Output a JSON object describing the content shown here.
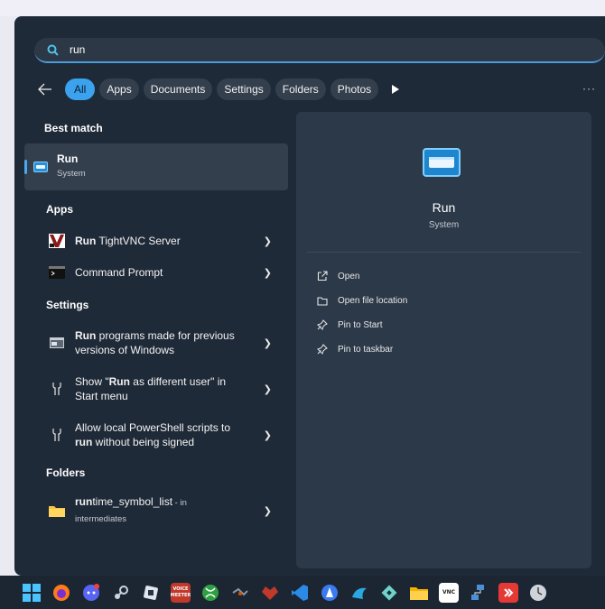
{
  "search": {
    "value": "run"
  },
  "filters": {
    "chips": [
      "All",
      "Apps",
      "Documents",
      "Settings",
      "Folders",
      "Photos"
    ],
    "more": "···"
  },
  "best_match": {
    "header": "Best match",
    "item": {
      "title": "Run",
      "subtitle": "System"
    }
  },
  "apps": {
    "header": "Apps",
    "items": [
      {
        "bold": "Run",
        "rest": " TightVNC Server"
      },
      {
        "bold": "",
        "rest": "Command Prompt"
      }
    ]
  },
  "settings": {
    "header": "Settings",
    "items": [
      {
        "line1_bold": "Run",
        "line1_rest": " programs made for previous",
        "line2_bold": "",
        "line2_rest": "versions of Windows"
      },
      {
        "line1_bold": "",
        "line1_rest": "Show \"",
        "line1_bold2": "Run",
        "line1_rest2": " as different user\" in",
        "line2_bold": "",
        "line2_rest": "Start menu"
      },
      {
        "line1_bold": "",
        "line1_rest": "Allow local PowerShell scripts to",
        "line2_bold": "run",
        "line2_rest": " without being signed"
      }
    ]
  },
  "folders": {
    "header": "Folders",
    "items": [
      {
        "bold": "run",
        "rest": "time_symbol_list",
        "suffix": " - in",
        "sub": "intermediates"
      }
    ]
  },
  "detail": {
    "title": "Run",
    "subtitle": "System",
    "actions": [
      "Open",
      "Open file location",
      "Pin to Start",
      "Pin to taskbar"
    ]
  },
  "taskbar": {
    "icons": [
      "start-icon",
      "firefox-icon",
      "discord-icon",
      "steam-icon",
      "app-icon",
      "voicemeeter-icon",
      "xbox-icon",
      "app2-icon",
      "app3-icon",
      "vscode-icon",
      "app4-icon",
      "app5-icon",
      "app6-icon",
      "file-explorer-icon",
      "tightvnc-icon",
      "network-icon",
      "app7-icon",
      "clock-icon"
    ],
    "voicemeeter_label": "VOICE\nMEETER",
    "vnc_label": "VNC"
  },
  "colors": {
    "accent": "#3aa2ee",
    "panel": "#1f2a38",
    "detail_panel": "#2c3949"
  }
}
